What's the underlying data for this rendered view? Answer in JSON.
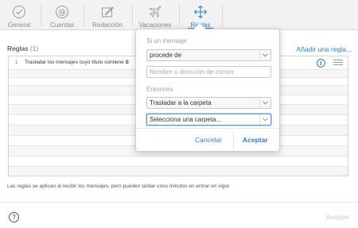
{
  "toolbar": {
    "tabs": [
      {
        "label": "General",
        "icon": "general-check-icon",
        "active": false
      },
      {
        "label": "Cuentas",
        "icon": "at-sign-icon",
        "active": false
      },
      {
        "label": "Redacción",
        "icon": "compose-icon",
        "active": false
      },
      {
        "label": "Vacaciones",
        "icon": "airplane-icon",
        "active": false
      },
      {
        "label": "Reglas",
        "icon": "rules-arrows-icon",
        "active": true
      }
    ]
  },
  "rules": {
    "title": "Reglas",
    "count": "(1)",
    "add_label": "Añadir una regla...",
    "items": [
      {
        "number": "1",
        "text": "Trasladar los mensajes cuyo título contiene",
        "bold_fragment": "S"
      }
    ]
  },
  "popover": {
    "condition_label": "Si un mensaje",
    "condition_value": "procede de",
    "email_placeholder": "Nombre o dirección de correo",
    "action_label": "Entonces",
    "action_value": "Trasladar a la carpeta",
    "folder_value": "Selecciona una carpeta...",
    "cancel_label": "Cancelar",
    "accept_label": "Aceptar"
  },
  "footer": {
    "note": "Las reglas se aplican al recibir los mensajes, pero pueden tardar unos minutos en entrar en vigor.",
    "help_symbol": "?",
    "accept_label": "Aceptar"
  },
  "colors": {
    "accent": "#2a7fd6",
    "toolbar_bg": "#f2f2f2",
    "disabled_text": "#c8c8c8"
  }
}
